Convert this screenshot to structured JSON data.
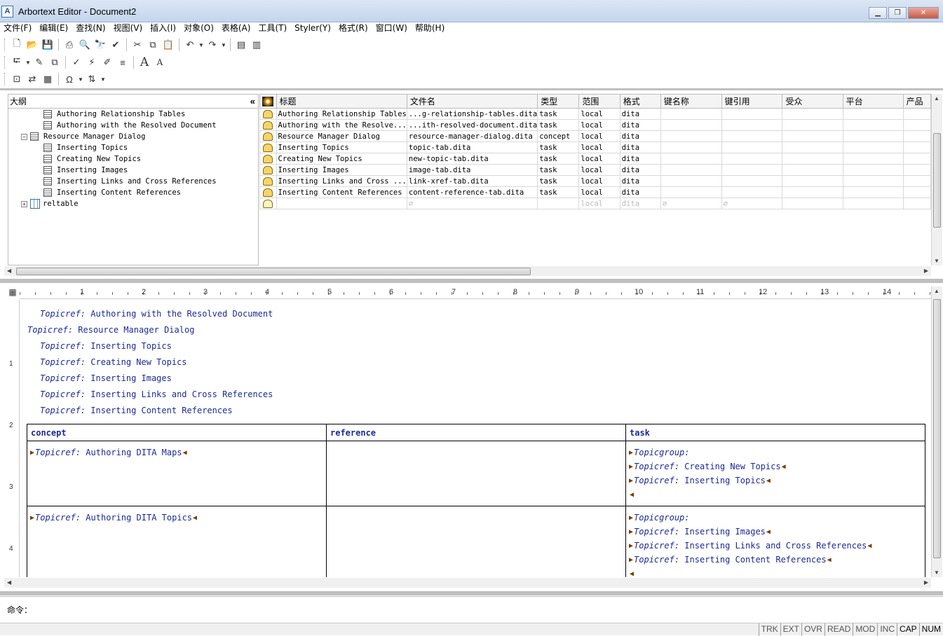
{
  "window": {
    "title": "Arbortext Editor - Document2",
    "app_icon": "A"
  },
  "menu": [
    "文件(F)",
    "编辑(E)",
    "查找(N)",
    "视图(V)",
    "插入(I)",
    "对象(O)",
    "表格(A)",
    "工具(T)",
    "Styler(Y)",
    "格式(R)",
    "窗口(W)",
    "帮助(H)"
  ],
  "outline": {
    "title": "大纲",
    "collapse_glyph": "«",
    "items": [
      {
        "label": "Authoring Relationship Tables"
      },
      {
        "label": "Authoring with the Resolved Document"
      },
      {
        "label": "Resource Manager Dialog"
      },
      {
        "label": "Inserting Topics"
      },
      {
        "label": "Creating New Topics"
      },
      {
        "label": "Inserting Images"
      },
      {
        "label": "Inserting Links and Cross References"
      },
      {
        "label": "Inserting Content References"
      },
      {
        "label": "reltable"
      }
    ]
  },
  "grid": {
    "columns": [
      "标题",
      "文件名",
      "类型",
      "范围",
      "格式",
      "键名称",
      "键引用",
      "受众",
      "平台",
      "产品"
    ],
    "rows": [
      [
        "Authoring Relationship Tables",
        "...g-relationship-tables.dita",
        "task",
        "local",
        "dita",
        "",
        "",
        "",
        "",
        ""
      ],
      [
        "Authoring with the Resolve...",
        "...ith-resolved-document.dita",
        "task",
        "local",
        "dita",
        "",
        "",
        "",
        "",
        ""
      ],
      [
        "Resource Manager Dialog",
        "resource-manager-dialog.dita",
        "concept",
        "local",
        "dita",
        "",
        "",
        "",
        "",
        ""
      ],
      [
        "Inserting Topics",
        "topic-tab.dita",
        "task",
        "local",
        "dita",
        "",
        "",
        "",
        "",
        ""
      ],
      [
        "Creating New Topics",
        "new-topic-tab.dita",
        "task",
        "local",
        "dita",
        "",
        "",
        "",
        "",
        ""
      ],
      [
        "Inserting Images",
        "image-tab.dita",
        "task",
        "local",
        "dita",
        "",
        "",
        "",
        "",
        ""
      ],
      [
        "Inserting Links and Cross ...",
        "link-xref-tab.dita",
        "task",
        "local",
        "dita",
        "",
        "",
        "",
        "",
        ""
      ],
      [
        "Inserting Content References",
        "content-reference-tab.dita",
        "task",
        "local",
        "dita",
        "",
        "",
        "",
        "",
        ""
      ],
      [
        "",
        "∅",
        "",
        "local",
        "dita",
        "∅",
        "∅",
        "",
        "",
        ""
      ]
    ]
  },
  "ruler": {
    "labels": [
      "1",
      "2",
      "3",
      "4",
      "5",
      "6",
      "7",
      "8",
      "9",
      "10",
      "11",
      "12",
      "13",
      "14"
    ],
    "vlabels": [
      "1",
      "2",
      "3",
      "4"
    ]
  },
  "editor": {
    "topicrefs": [
      {
        "tag": "Topicref:",
        "text": "Authoring with the Resolved Document"
      },
      {
        "tag": "Topicref:",
        "text": "Resource Manager Dialog"
      },
      {
        "tag": "Topicref:",
        "text": "Inserting Topics"
      },
      {
        "tag": "Topicref:",
        "text": "Creating New Topics"
      },
      {
        "tag": "Topicref:",
        "text": "Inserting Images"
      },
      {
        "tag": "Topicref:",
        "text": "Inserting Links and Cross References"
      },
      {
        "tag": "Topicref:",
        "text": "Inserting Content References"
      }
    ],
    "reltable": {
      "headers": [
        "concept",
        "reference",
        "task"
      ],
      "rows": [
        {
          "concept": [
            {
              "tag": "Topicref:",
              "text": "Authoring DITA Maps"
            }
          ],
          "task": [
            {
              "tag": "Topicgroup:",
              "text": ""
            },
            {
              "tag": "Topicref:",
              "text": "Creating New Topics"
            },
            {
              "tag": "Topicref:",
              "text": "Inserting Topics"
            }
          ]
        },
        {
          "concept": [
            {
              "tag": "Topicref:",
              "text": "Authoring DITA Topics"
            }
          ],
          "task": [
            {
              "tag": "Topicgroup:",
              "text": ""
            },
            {
              "tag": "Topicref:",
              "text": "Inserting Images"
            },
            {
              "tag": "Topicref:",
              "text": "Inserting Links and Cross References"
            },
            {
              "tag": "Topicref:",
              "text": "Inserting Content References"
            }
          ]
        }
      ]
    }
  },
  "command": {
    "label": "命令：",
    "value": ""
  },
  "status": [
    "TRK",
    "EXT",
    "OVR",
    "READ",
    "MOD",
    "INC",
    "CAP",
    "NUM"
  ],
  "status_active": [
    "CAP",
    "NUM"
  ]
}
